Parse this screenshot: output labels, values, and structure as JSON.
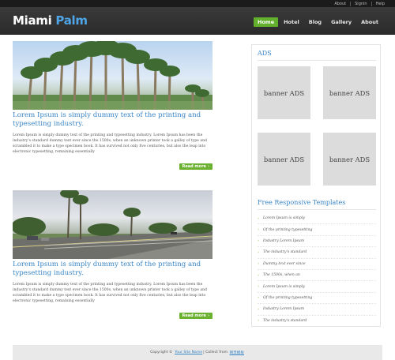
{
  "toplinks": [
    "About",
    "Signin",
    "Help"
  ],
  "logo": {
    "part1": "Miami",
    "part2": "Palm"
  },
  "nav": {
    "items": [
      "Home",
      "Hotel",
      "Blog",
      "Gallery",
      "About"
    ],
    "active_index": 0
  },
  "posts": [
    {
      "title": "Lorem Ipsum is simply dummy text of the printing and typesetting industry.",
      "text": "Lorem Ipsum is simply dummy text of the printing and typesetting industry. Lorem Ipsum has been the industry's standard dummy text ever since the 1500s, when an unknown printer took a galley of type and scrambled it to make a type specimen book. It has survived not only five centuries, but also the leap into electronic typesetting, remaining essentially",
      "readmore": "Read more"
    },
    {
      "title": "Lorem Ipsum is simply dummy text of the printing and typesetting industry.",
      "text": "Lorem Ipsum is simply dummy text of the printing and typesetting industry. Lorem Ipsum has been the industry's standard dummy text ever since the 1500s, when an unknown printer took a galley of type and scrambled it to make a type specimen book. It has survived not only five centuries, but also the leap into electronic typesetting, remaining essentially",
      "readmore": "Read more"
    }
  ],
  "sidebar": {
    "ads_heading": "ADS",
    "banners": [
      "banner ADS",
      "banner ADS",
      "banner ADS",
      "banner ADS"
    ],
    "templates_heading": "Free Responsive Templates",
    "templates": [
      "Lorem Ipsum is simply",
      "Of the printing typesetting",
      "Industry Lorem Ipsum",
      "The industry's standard",
      "Dummy text ever since",
      "The 1500s, when an",
      "Lorem Ipsum is simply",
      "Of the printing typesetting",
      "Industry Lorem Ipsum",
      "The industry's standard"
    ]
  },
  "footer": {
    "prefix": "Copyright ©",
    "site_name": "Your Site Name",
    "middle": "| Collect from",
    "link": "网页模板"
  },
  "colors": {
    "accent_blue": "#3a86c6",
    "accent_green": "#62b02b",
    "header_bg": "#2f2f2f"
  }
}
